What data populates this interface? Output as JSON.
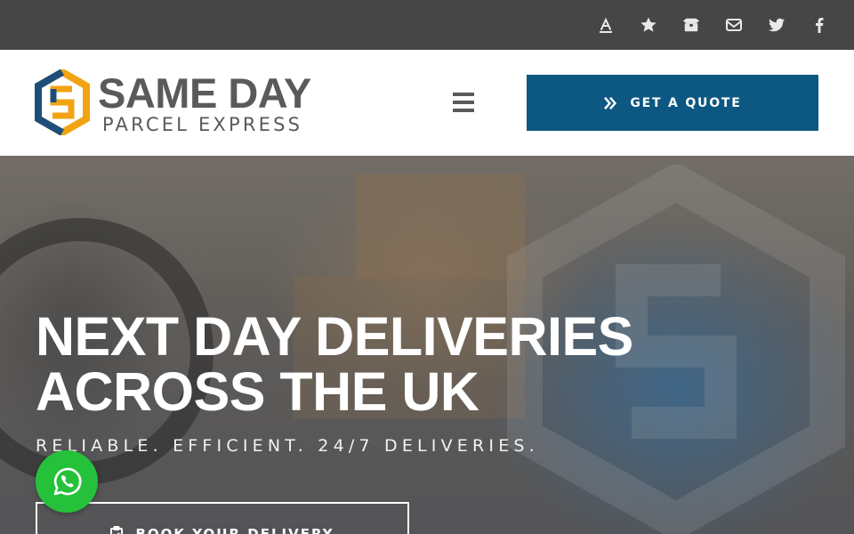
{
  "topbar": {
    "icons": [
      "trustpilot-icon",
      "star-icon",
      "box-icon",
      "envelope-icon",
      "twitter-icon",
      "facebook-icon"
    ]
  },
  "header": {
    "logo": {
      "line1": "SAME DAY",
      "line2": "PARCEL EXPRESS"
    },
    "quote_button": {
      "label": "GET A QUOTE",
      "icon": "double-chevron-right-icon"
    },
    "menu_icon": "hamburger-icon"
  },
  "hero": {
    "headline": "NEXT DAY DELIVERIES ACROSS THE UK",
    "tagline": "RELIABLE. EFFICIENT. 24/7 DELIVERIES.",
    "book_button": {
      "label": "BOOK YOUR DELIVERY",
      "icon": "clipboard-icon"
    }
  },
  "whatsapp": {
    "icon": "whatsapp-icon"
  },
  "colors": {
    "topbar": "#464646",
    "brand_blue": "#0d5882",
    "logo_grey": "#5a5a5a",
    "logo_orange": "#f2a312",
    "logo_dark_blue": "#1d4e7a",
    "whatsapp_green": "#25c13b"
  }
}
